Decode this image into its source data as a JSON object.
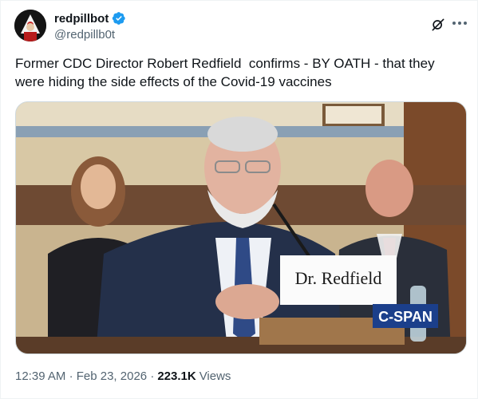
{
  "author": {
    "display_name": "redpillbot",
    "handle": "@redpillb0t",
    "verified": true,
    "accent": "#1d9bf0"
  },
  "tweet": {
    "text": "Former CDC Director Robert Redfield  confirms - BY OATH - that they were hiding the side effects of the Covid-19 vaccines"
  },
  "media": {
    "nameplate": "Dr. Redfield",
    "broadcaster_logo": "C-SPAN"
  },
  "meta": {
    "time": "12:39 AM",
    "separator": "·",
    "date": "Feb 23, 2026",
    "views_count": "223.1K",
    "views_label": "Views"
  },
  "icons": {
    "grok": "grok-icon",
    "more": "more-icon",
    "verified": "verified-badge-icon"
  }
}
